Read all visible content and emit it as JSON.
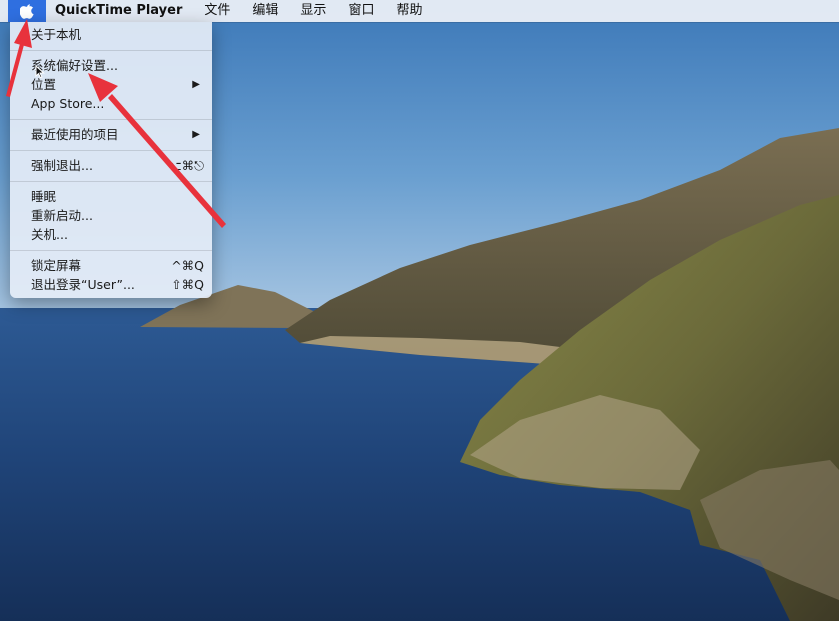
{
  "menubar": {
    "apple_icon": "apple-logo-icon",
    "items": [
      "QuickTime Player",
      "文件",
      "编辑",
      "显示",
      "窗口",
      "帮助"
    ]
  },
  "apple_menu": {
    "about": "关于本机",
    "system_prefs": "系统偏好设置...",
    "location": "位置",
    "app_store": "App Store...",
    "recent_items": "最近使用的项目",
    "force_quit": "强制退出...",
    "force_quit_shortcut": "⌥⌘⎋",
    "sleep": "睡眠",
    "restart": "重新启动...",
    "shutdown": "关机...",
    "lock_screen": "锁定屏幕",
    "lock_screen_shortcut": "^⌘Q",
    "logout": "退出登录“User”...",
    "logout_shortcut": "⇧⌘Q"
  },
  "colors": {
    "menu_highlight": "#2f6fe0",
    "annotation_arrow": "#e8323c"
  }
}
